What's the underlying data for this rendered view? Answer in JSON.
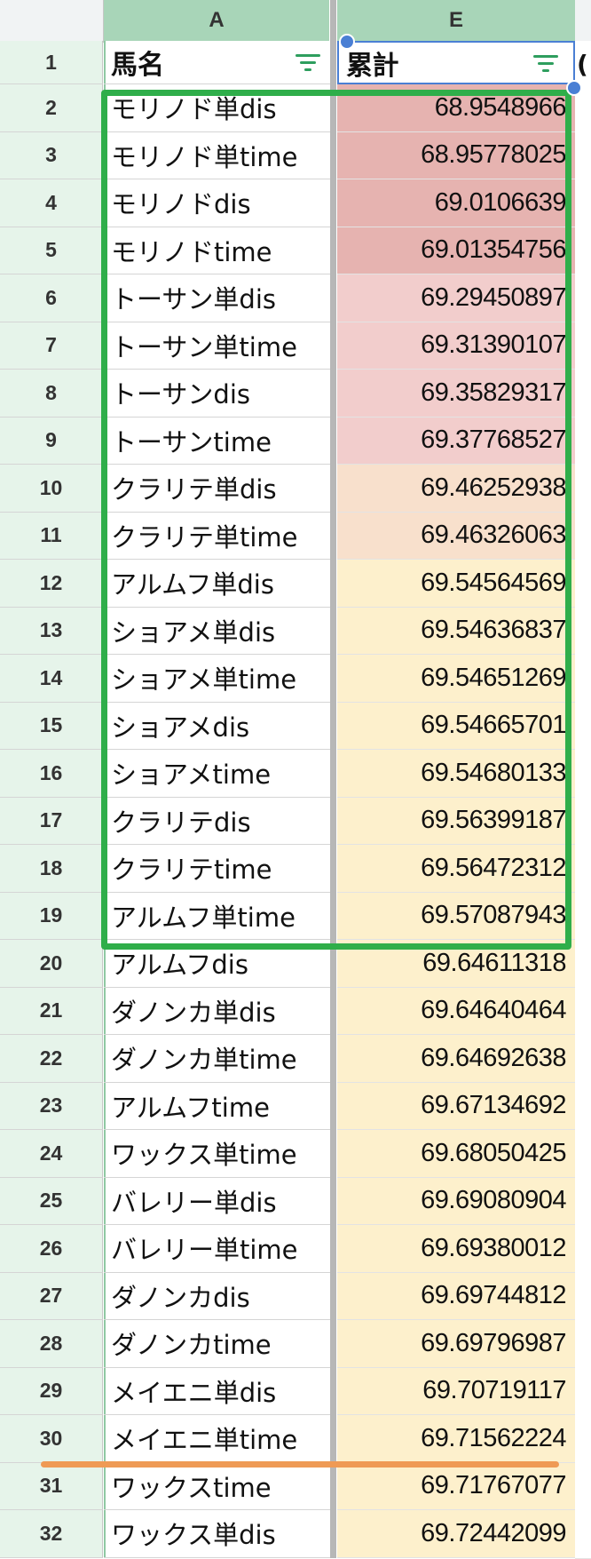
{
  "columns": {
    "a": "A",
    "e": "E"
  },
  "header": {
    "row_number": "1",
    "a_label": "馬名",
    "e_label": "累計",
    "overflow_text": "("
  },
  "rows": [
    {
      "n": "2",
      "name": "モリノド単dis",
      "value": "68.9548966",
      "color": "#e6b3b0"
    },
    {
      "n": "3",
      "name": "モリノド単time",
      "value": "68.95778025",
      "color": "#e6b3b0"
    },
    {
      "n": "4",
      "name": "モリノドdis",
      "value": "69.0106639",
      "color": "#e6b3b0"
    },
    {
      "n": "5",
      "name": "モリノドtime",
      "value": "69.01354756",
      "color": "#e6b3b0"
    },
    {
      "n": "6",
      "name": "トーサン単dis",
      "value": "69.29450897",
      "color": "#f2cdcc"
    },
    {
      "n": "7",
      "name": "トーサン単time",
      "value": "69.31390107",
      "color": "#f2cdcc"
    },
    {
      "n": "8",
      "name": "トーサンdis",
      "value": "69.35829317",
      "color": "#f2cdcc"
    },
    {
      "n": "9",
      "name": "トーサンtime",
      "value": "69.37768527",
      "color": "#f2cdcc"
    },
    {
      "n": "10",
      "name": "クラリテ単dis",
      "value": "69.46252938",
      "color": "#f8e0cc"
    },
    {
      "n": "11",
      "name": "クラリテ単time",
      "value": "69.46326063",
      "color": "#f8e0cc"
    },
    {
      "n": "12",
      "name": "アルムフ単dis",
      "value": "69.54564569",
      "color": "#fdf0cc"
    },
    {
      "n": "13",
      "name": "ショアメ単dis",
      "value": "69.54636837",
      "color": "#fdf0cc"
    },
    {
      "n": "14",
      "name": "ショアメ単time",
      "value": "69.54651269",
      "color": "#fdf0cc"
    },
    {
      "n": "15",
      "name": "ショアメdis",
      "value": "69.54665701",
      "color": "#fdf0cc"
    },
    {
      "n": "16",
      "name": "ショアメtime",
      "value": "69.54680133",
      "color": "#fdf0cc"
    },
    {
      "n": "17",
      "name": "クラリテdis",
      "value": "69.56399187",
      "color": "#fdf0cc"
    },
    {
      "n": "18",
      "name": "クラリテtime",
      "value": "69.56472312",
      "color": "#fdf0cc"
    },
    {
      "n": "19",
      "name": "アルムフ単time",
      "value": "69.57087943",
      "color": "#fdf0cc"
    },
    {
      "n": "20",
      "name": "アルムフdis",
      "value": "69.64611318",
      "color": "#fdf0cc"
    },
    {
      "n": "21",
      "name": "ダノンカ単dis",
      "value": "69.64640464",
      "color": "#fdf0cc"
    },
    {
      "n": "22",
      "name": "ダノンカ単time",
      "value": "69.64692638",
      "color": "#fdf0cc"
    },
    {
      "n": "23",
      "name": "アルムフtime",
      "value": "69.67134692",
      "color": "#fdf0cc"
    },
    {
      "n": "24",
      "name": "ワックス単time",
      "value": "69.68050425",
      "color": "#fdf0cc"
    },
    {
      "n": "25",
      "name": "バレリー単dis",
      "value": "69.69080904",
      "color": "#fdf0cc"
    },
    {
      "n": "26",
      "name": "バレリー単time",
      "value": "69.69380012",
      "color": "#fdf0cc"
    },
    {
      "n": "27",
      "name": "ダノンカdis",
      "value": "69.69744812",
      "color": "#fdf0cc"
    },
    {
      "n": "28",
      "name": "ダノンカtime",
      "value": "69.69796987",
      "color": "#fdf0cc"
    },
    {
      "n": "29",
      "name": "メイエニ単dis",
      "value": "69.70719117",
      "color": "#fdf0cc"
    },
    {
      "n": "30",
      "name": "メイエニ単time",
      "value": "69.71562224",
      "color": "#fdf0cc"
    },
    {
      "n": "31",
      "name": "ワックスtime",
      "value": "69.71767077",
      "color": "#fdf0cc"
    },
    {
      "n": "32",
      "name": "ワックス単dis",
      "value": "69.72442099",
      "color": "#fdf0cc"
    }
  ],
  "colors": {
    "highlight_box": "#2fae4a",
    "underline": "#ef9a55",
    "selection": "#4a7fd4",
    "column_header": "#a8d5b8"
  }
}
